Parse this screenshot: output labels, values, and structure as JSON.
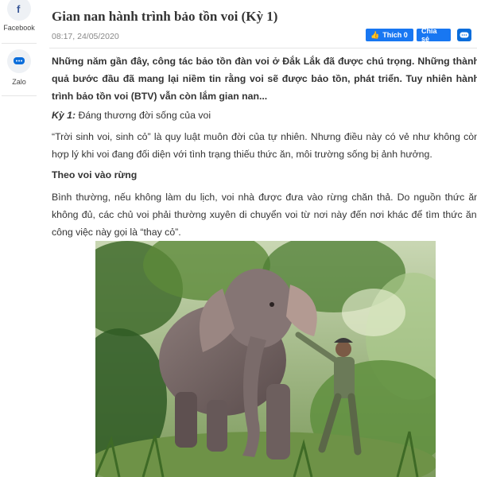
{
  "share": {
    "facebook_label": "Facebook",
    "zalo_label": "Zalo"
  },
  "article": {
    "title": "Gian nan hành trình bảo tồn voi (Kỳ 1)",
    "datetime": "08:17, 24/05/2020",
    "fb_like_label": "Thích 0",
    "fb_share_label": "Chia sẻ",
    "lead": "Những năm gần đây, công tác bảo tồn đàn voi ở Đắk Lắk đã được chú trọng. Những thành quả bước đầu đã mang lại niềm tin rằng voi sẽ được bảo tồn, phát triển. Tuy nhiên hành trình bảo tồn voi (BTV) vẫn còn lắm gian nan...",
    "chapter_label": "Kỳ 1:",
    "chapter_title": " Đáng thương đời sống của voi",
    "paragraph1": "“Trời sinh voi, sinh cỏ” là quy luật muôn đời của tự nhiên. Nhưng điều này có vẻ như không còn hợp lý khi voi đang đối diện với tình trạng thiếu thức ăn, môi trường sống bị ảnh hưởng.",
    "subheading": "Theo voi vào rừng",
    "paragraph2": "Bình thường, nếu không làm du lịch, voi nhà được đưa vào rừng chăn thả. Do nguồn thức ăn không đủ, các chủ voi phải thường xuyên di chuyển voi từ nơi này đến nơi khác để tìm thức ăn, công việc này gọi là “thay cỏ”."
  },
  "colors": {
    "facebook_blue": "#1877f2",
    "zalo_blue": "#0a6ddb"
  },
  "icons": [
    "facebook-icon",
    "zalo-icon",
    "thumbs-up-icon"
  ]
}
